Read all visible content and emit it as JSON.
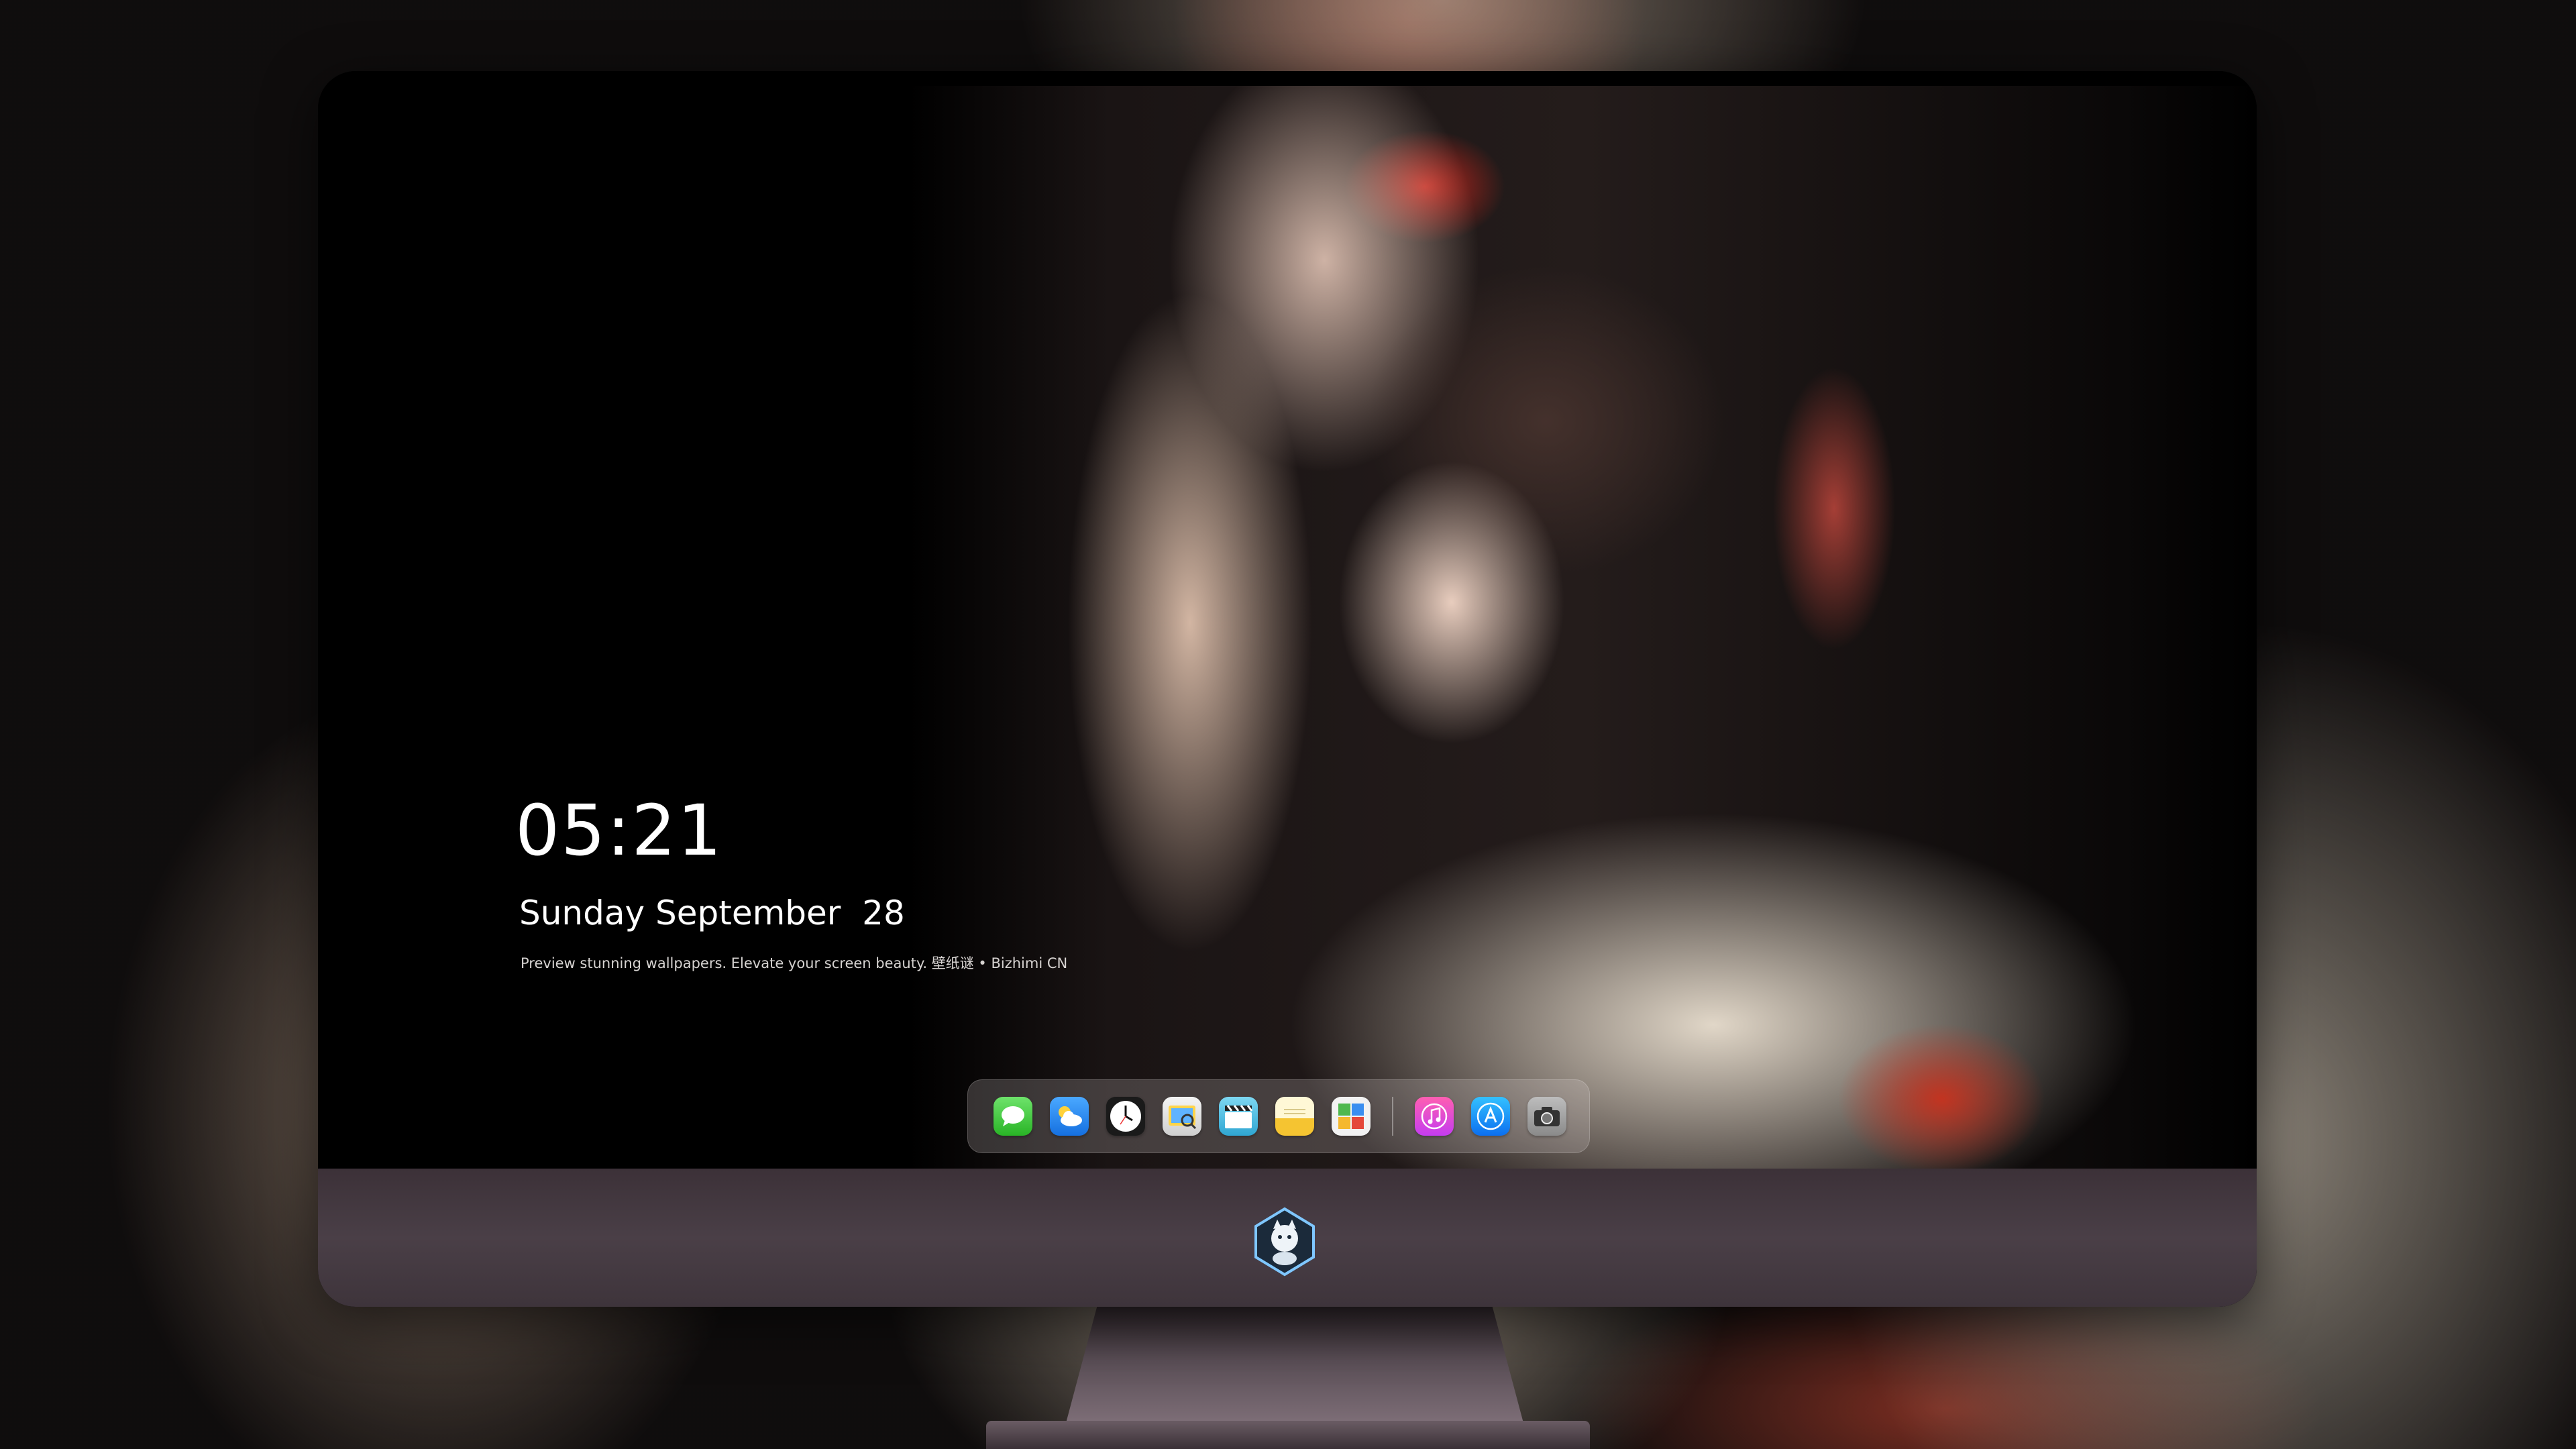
{
  "lockscreen": {
    "time": "05:21",
    "date": "Sunday September  28",
    "tagline": "Preview stunning wallpapers. Elevate your screen beauty. 壁纸谜 • Bizhimi CN"
  },
  "dock": {
    "apps": [
      {
        "icon": "messages-icon",
        "label": "Messages"
      },
      {
        "icon": "weather-icon",
        "label": "Weather"
      },
      {
        "icon": "clock-icon",
        "label": "Clock"
      },
      {
        "icon": "preview-icon",
        "label": "Preview"
      },
      {
        "icon": "clapperboard-icon",
        "label": "Video"
      },
      {
        "icon": "notes-icon",
        "label": "Notes"
      },
      {
        "icon": "photos-icon",
        "label": "Photos"
      }
    ],
    "pinned": [
      {
        "icon": "music-icon",
        "label": "Music"
      },
      {
        "icon": "app-store-icon",
        "label": "App Store"
      },
      {
        "icon": "camera-icon",
        "label": "Camera"
      }
    ]
  },
  "colors": {
    "chin": "#4a3f47",
    "dock_bg": "rgba(220,210,210,0.22)",
    "text": "#ffffff"
  },
  "chin_logo": "mascot-logo-icon"
}
